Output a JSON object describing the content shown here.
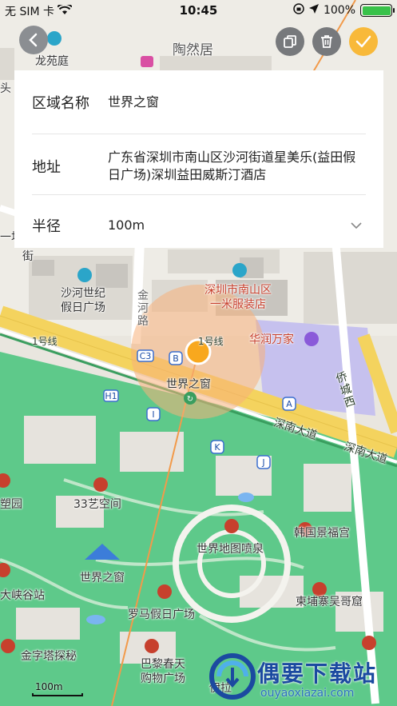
{
  "status_bar": {
    "carrier": "无 SIM 卡",
    "time": "10:45",
    "battery": "100%",
    "battery_level": 1.0
  },
  "toolbar": {
    "back_icon": "chevron-left-icon",
    "copy_icon": "copy-icon",
    "delete_icon": "trash-icon",
    "confirm_icon": "check-icon"
  },
  "form": {
    "name_label": "区域名称",
    "name_value": "世界之窗",
    "address_label": "地址",
    "address_value": "广东省深圳市南山区沙河街道星美乐(益田假日广场)深圳益田威斯汀酒店",
    "radius_label": "半径",
    "radius_value": "100m"
  },
  "map": {
    "labels": {
      "longyuanting": "龙苑庭",
      "taoranju": "陶然居",
      "shahe": "沙河世纪\n假日广场",
      "nanshan": "深圳市南山区\n一米服装店",
      "huarun": "华润万家",
      "line1": "1号线",
      "line1b": "1号线",
      "window_center": "世界之窗",
      "shennan": "深南大道",
      "shennan2": "深南大道",
      "qiaocheng": "侨\n城\n西",
      "space33": "33艺空间",
      "fountain": "世界地图喷泉",
      "korea": "韩国景福宫",
      "window2": "世界之窗",
      "canyon": "大峡谷站",
      "roma": "罗马假日广场",
      "cambodia": "柬埔寨吴哥窟",
      "golden": "金字塔探秘",
      "paris": "巴黎春天\n购物广场",
      "yila": "伊拉",
      "garden": "塑园",
      "jie": "街",
      "chang": "一场",
      "tou": "头",
      "jinhe": "金\n河\n路"
    },
    "scale": "100m"
  },
  "watermark": {
    "main": "偶要下载站",
    "sub": "ouyaoxiazai.com"
  },
  "colors": {
    "accent": "#f8b93a",
    "park": "#5ec98a",
    "road": "#f4d35e",
    "radius_fill": "#f8b07a"
  }
}
